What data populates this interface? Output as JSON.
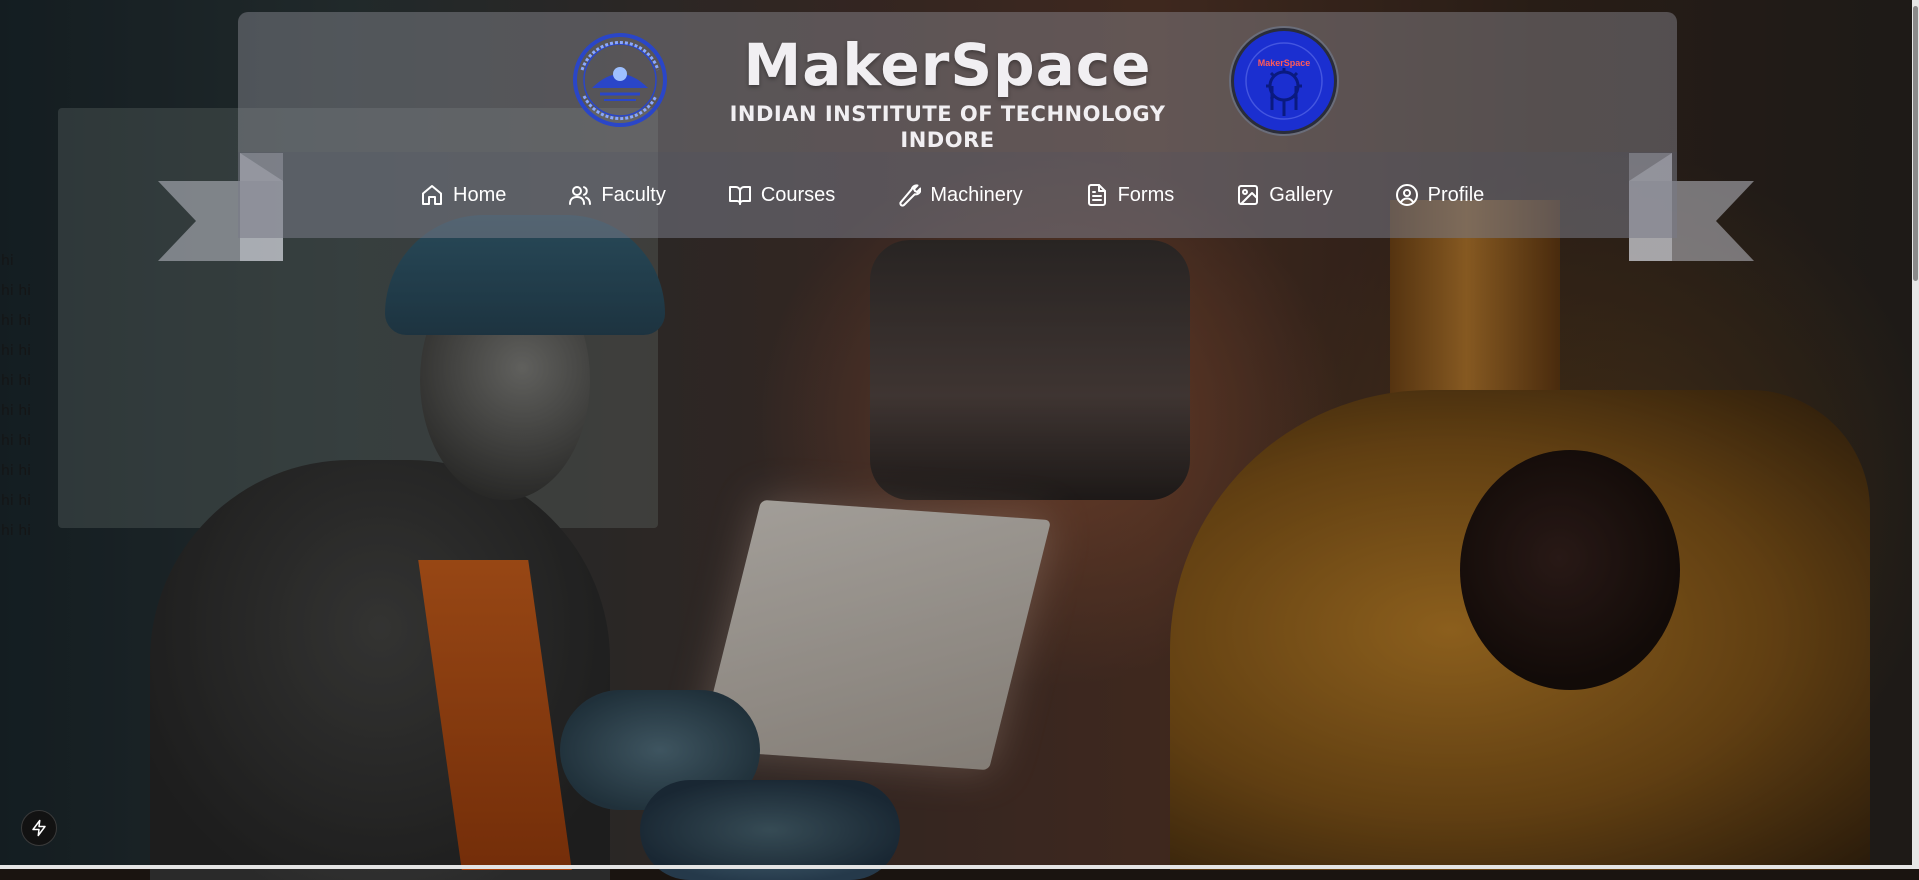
{
  "header": {
    "title": "MakerSpace",
    "subtitle": "INDIAN INSTITUTE OF TECHNOLOGY INDORE",
    "logo_left": {
      "icon": "iit-indore-logo"
    },
    "logo_right": {
      "icon": "makerspace-logo",
      "text": "MakerSpace"
    }
  },
  "nav": {
    "items": [
      {
        "label": "Home",
        "icon": "home-icon"
      },
      {
        "label": "Faculty",
        "icon": "users-icon"
      },
      {
        "label": "Courses",
        "icon": "book-icon"
      },
      {
        "label": "Machinery",
        "icon": "wrench-icon"
      },
      {
        "label": "Forms",
        "icon": "file-text-icon"
      },
      {
        "label": "Gallery",
        "icon": "image-icon"
      },
      {
        "label": "Profile",
        "icon": "user-circle-icon"
      }
    ]
  },
  "stray_text": {
    "lines": [
      "hi",
      "hi hi",
      "hi hi",
      "hi hi",
      "hi hi",
      "hi hi",
      "hi hi",
      "hi hi",
      "hi hi",
      "hi hi"
    ]
  },
  "floating_button": {
    "icon": "bolt-icon"
  },
  "colors": {
    "header_text": "#f1eff2",
    "logo_blue": "#1b2fd0",
    "nav_text": "#ffffff"
  }
}
